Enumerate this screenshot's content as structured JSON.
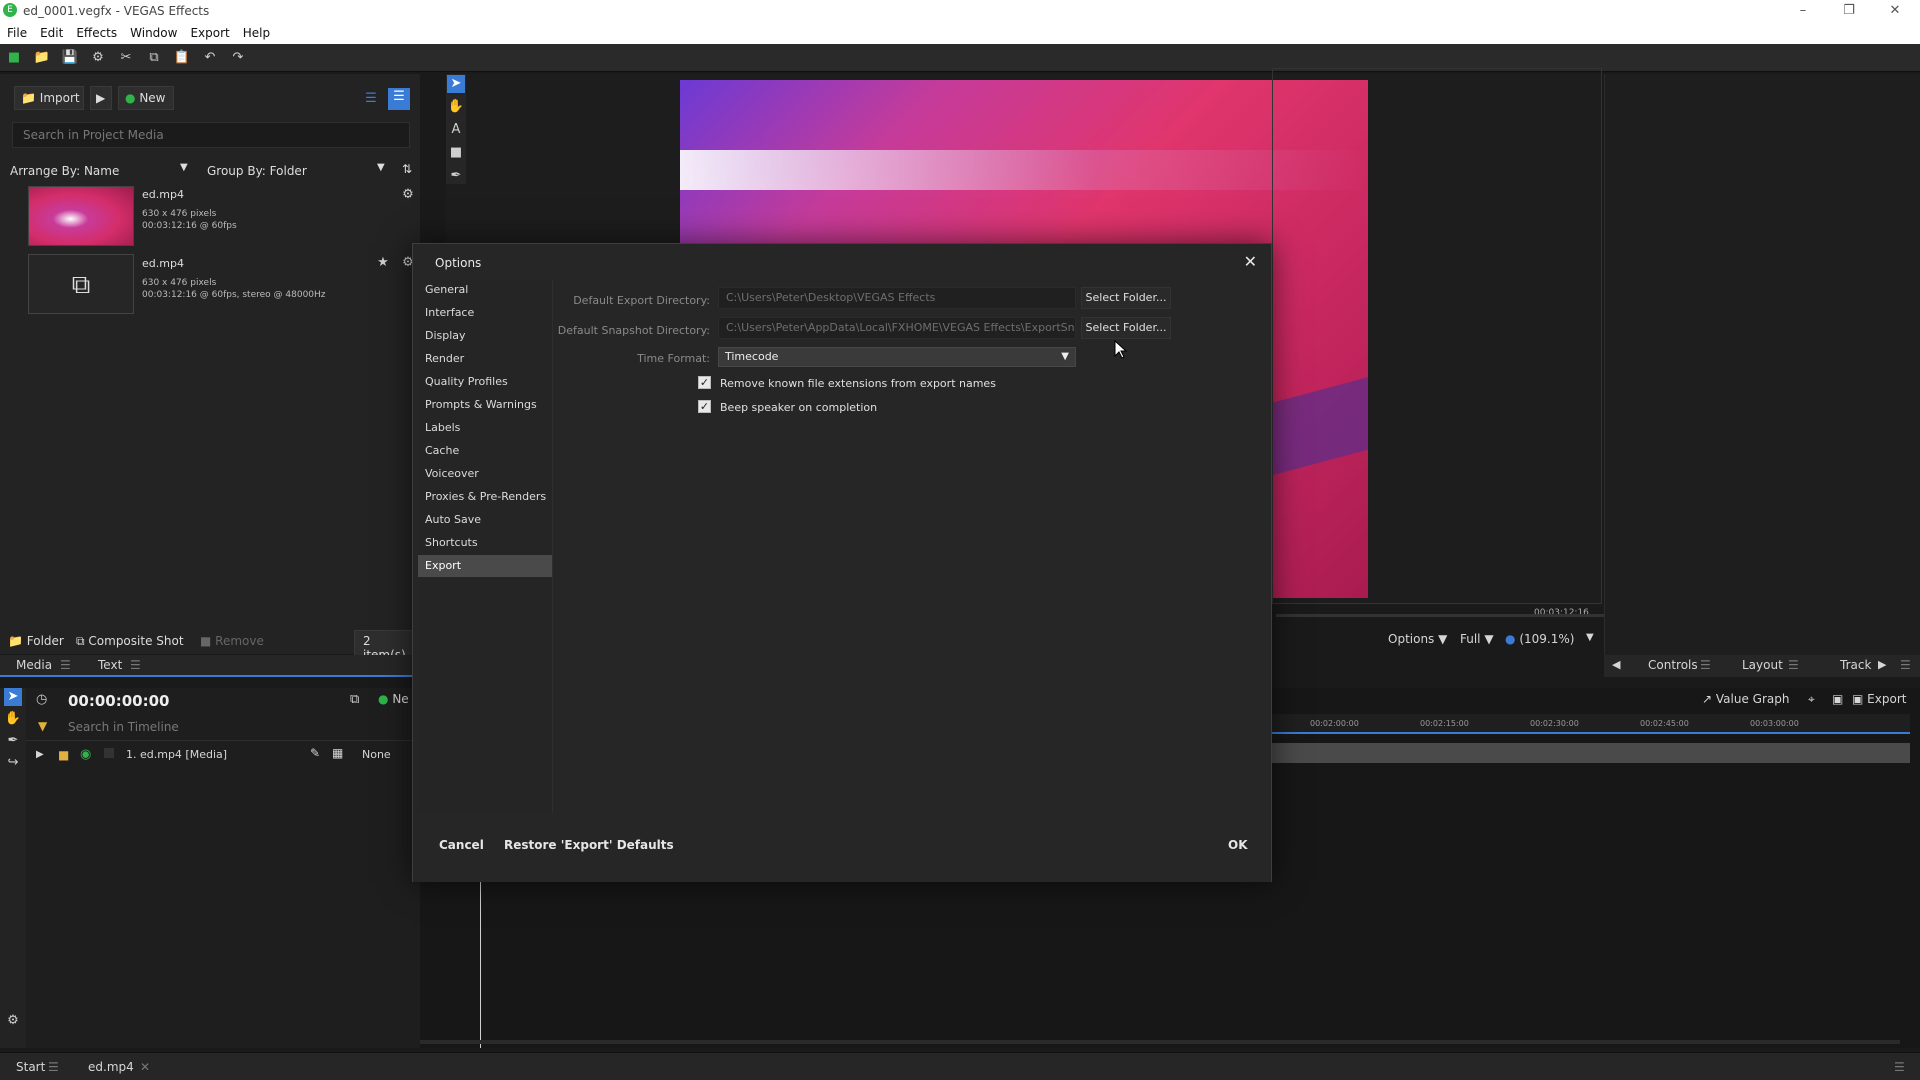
{
  "window": {
    "title": "ed_0001.vegfx - VEGAS Effects",
    "app_icon": "E"
  },
  "menu": [
    "File",
    "Edit",
    "Effects",
    "Window",
    "Export",
    "Help"
  ],
  "media_panel": {
    "import_label": "Import",
    "new_label": "New",
    "search_placeholder": "Search in Project Media",
    "arrange_label": "Arrange By: Name",
    "group_label": "Group By: Folder",
    "items": [
      {
        "name": "ed.mp4",
        "line1": "630 x 476 pixels",
        "line2": "00:03:12:16 @ 60fps"
      },
      {
        "name": "ed.mp4",
        "line1": "630 x 476 pixels",
        "line2": "00:03:12:16 @ 60fps, stereo @ 48000Hz"
      }
    ],
    "folder_label": "Folder",
    "composite_label": "Composite Shot",
    "remove_label": "Remove",
    "count_label": "2 item(s)",
    "tabs": [
      "Media",
      "Text"
    ]
  },
  "viewer": {
    "time": "00:03:12:16",
    "options_label": "Options",
    "quality_label": "Full",
    "zoom_label": "(109.1%)"
  },
  "right_tabs": {
    "controls": "Controls",
    "layout": "Layout",
    "track": "Track"
  },
  "timeline": {
    "timecode": "00:00:00:00",
    "new_label": "Ne",
    "search_placeholder": "Search in Timeline",
    "track_name": "1. ed.mp4 [Media]",
    "blend_label": "None",
    "value_graph": "Value Graph",
    "export_label": "Export",
    "ruler": [
      "00:02:00:00",
      "00:02:15:00",
      "00:02:30:00",
      "00:02:45:00",
      "00:03:00:00"
    ]
  },
  "status_tabs": {
    "start": "Start",
    "file": "ed.mp4"
  },
  "dialog": {
    "title": "Options",
    "nav": [
      "General",
      "Interface",
      "Display",
      "Render",
      "Quality Profiles",
      "Prompts & Warnings",
      "Labels",
      "Cache",
      "Voiceover",
      "Proxies & Pre-Renders",
      "Auto Save",
      "Shortcuts",
      "Export"
    ],
    "active_nav": "Export",
    "export_dir_label": "Default Export Directory:",
    "export_dir_value": "C:\\Users\\Peter\\Desktop\\VEGAS Effects",
    "snapshot_dir_label": "Default Snapshot Directory:",
    "snapshot_dir_value": "C:\\Users\\Peter\\AppData\\Local\\FXHOME\\VEGAS Effects\\ExportSnapshots",
    "select_folder_label": "Select Folder...",
    "time_format_label": "Time Format:",
    "time_format_value": "Timecode",
    "check1_label": "Remove known file extensions from export names",
    "check2_label": "Beep speaker on completion",
    "cancel_label": "Cancel",
    "restore_label": "Restore 'Export' Defaults",
    "ok_label": "OK"
  },
  "colors": {
    "accent": "#3a7bd5",
    "preview_pink": "#e0356d",
    "dialog_bg": "#262626"
  }
}
